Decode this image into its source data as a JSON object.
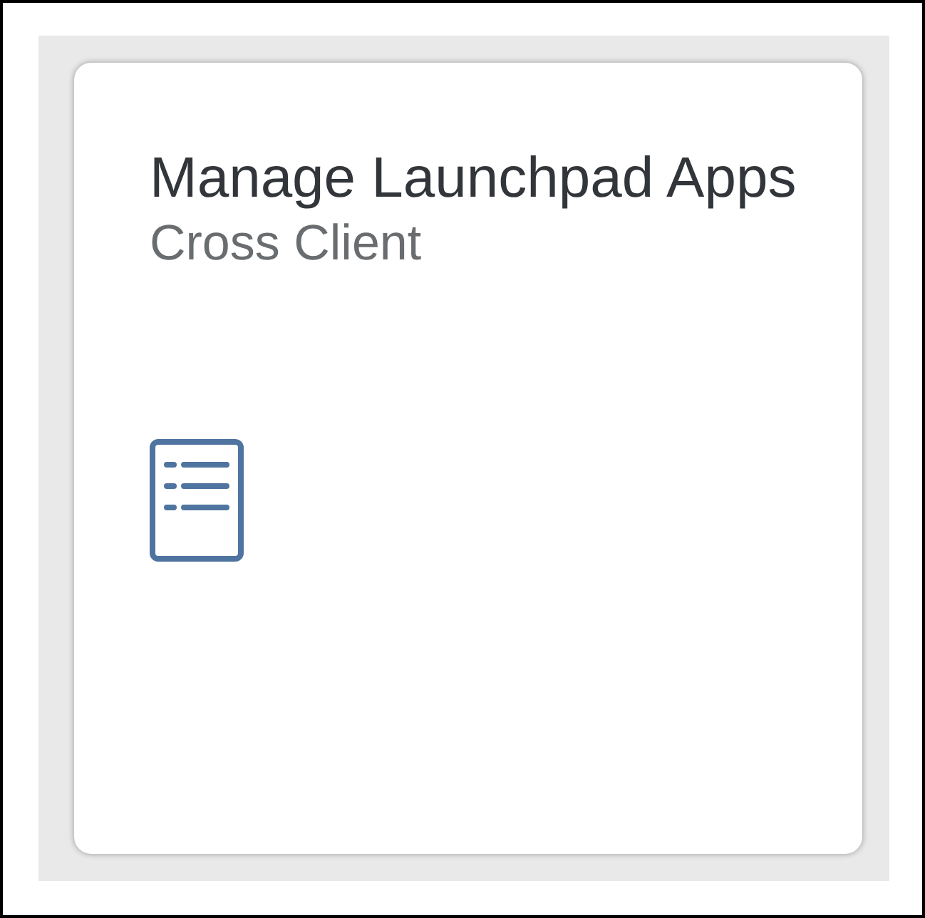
{
  "tile": {
    "title": "Manage Launchpad Apps",
    "subtitle": "Cross Client"
  }
}
